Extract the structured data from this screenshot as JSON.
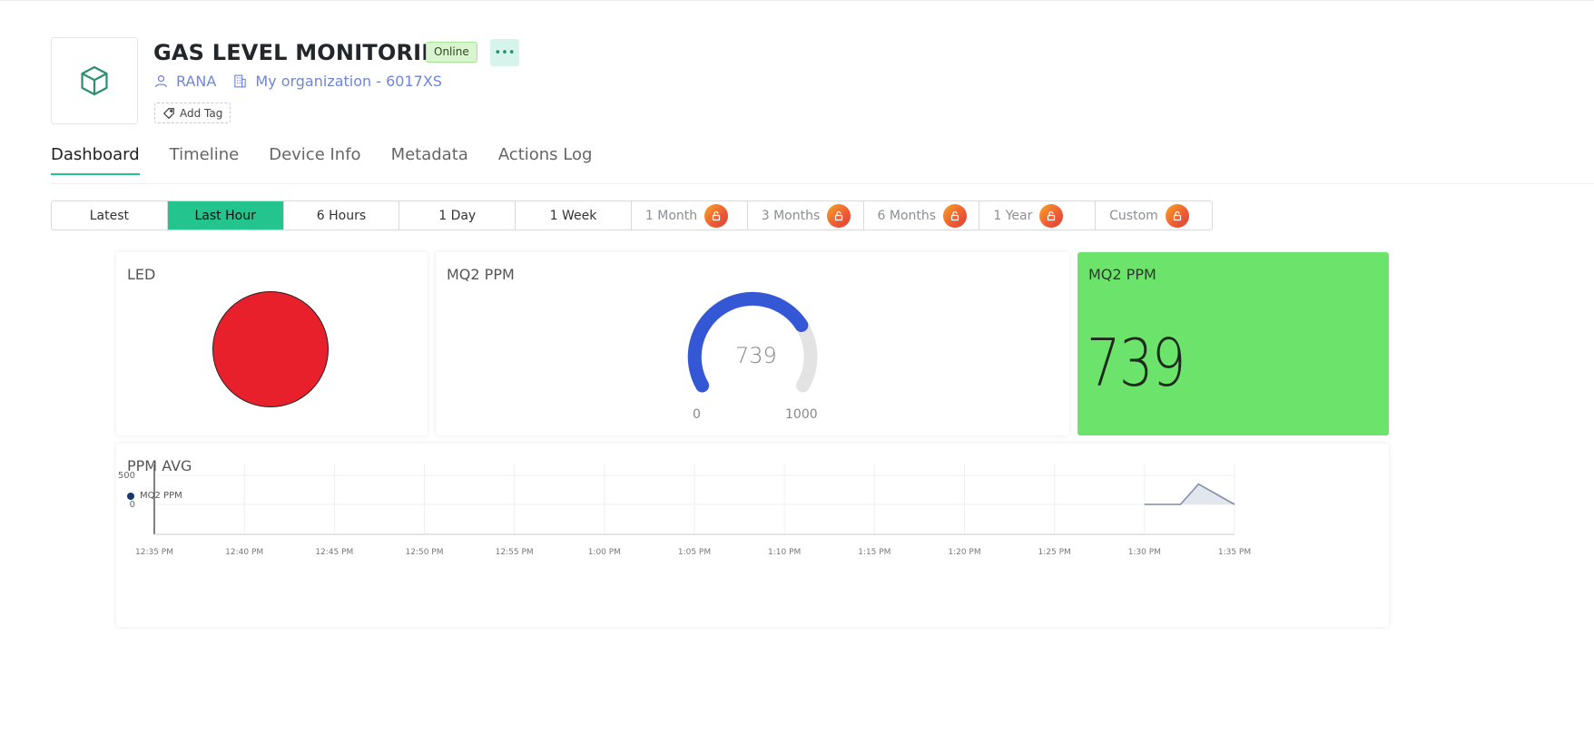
{
  "device": {
    "title": "GAS LEVEL MONITORING",
    "status": "Online",
    "more_label": "•••",
    "owner": "RANA",
    "organization": "My organization - 6017XS",
    "add_tag": "Add Tag",
    "icon": "cube-icon"
  },
  "tabs": [
    {
      "label": "Dashboard",
      "active": true
    },
    {
      "label": "Timeline",
      "active": false
    },
    {
      "label": "Device Info",
      "active": false
    },
    {
      "label": "Metadata",
      "active": false
    },
    {
      "label": "Actions Log",
      "active": false
    }
  ],
  "time_ranges": [
    {
      "label": "Latest",
      "active": false,
      "locked": false
    },
    {
      "label": "Last Hour",
      "active": true,
      "locked": false
    },
    {
      "label": "6 Hours",
      "active": false,
      "locked": false
    },
    {
      "label": "1 Day",
      "active": false,
      "locked": false
    },
    {
      "label": "1 Week",
      "active": false,
      "locked": false
    },
    {
      "label": "1 Month",
      "active": false,
      "locked": true
    },
    {
      "label": "3 Months",
      "active": false,
      "locked": true
    },
    {
      "label": "6 Months",
      "active": false,
      "locked": true
    },
    {
      "label": "1 Year",
      "active": false,
      "locked": true
    },
    {
      "label": "Custom",
      "active": false,
      "locked": true
    }
  ],
  "widgets": {
    "led": {
      "title": "LED",
      "color": "#e8202c"
    },
    "gauge": {
      "title": "MQ2 PPM",
      "value": "739",
      "min": "0",
      "max": "1000",
      "value_num": 739,
      "min_num": 0,
      "max_num": 1000,
      "color": "#3457d5"
    },
    "value": {
      "title": "MQ2 PPM",
      "value": "739",
      "background": "#6ce36a"
    },
    "chart": {
      "title": "PPM AVG"
    }
  },
  "colors": {
    "accent": "#23c48e",
    "link": "#6f86d9"
  },
  "chart_data": {
    "type": "area",
    "title": "PPM AVG",
    "series": [
      {
        "name": "MQ2 PPM",
        "x": [
          "1:30 PM",
          "1:32 PM",
          "1:33 PM",
          "1:35 PM"
        ],
        "values": [
          0,
          0,
          350,
          0
        ]
      }
    ],
    "x_ticks": [
      "12:35 PM",
      "12:40 PM",
      "12:45 PM",
      "12:50 PM",
      "12:55 PM",
      "1:00 PM",
      "1:05 PM",
      "1:10 PM",
      "1:15 PM",
      "1:20 PM",
      "1:25 PM",
      "1:30 PM",
      "1:35 PM"
    ],
    "y_ticks": [
      "500",
      "0"
    ],
    "legend_position": "top-left",
    "grid": true
  }
}
